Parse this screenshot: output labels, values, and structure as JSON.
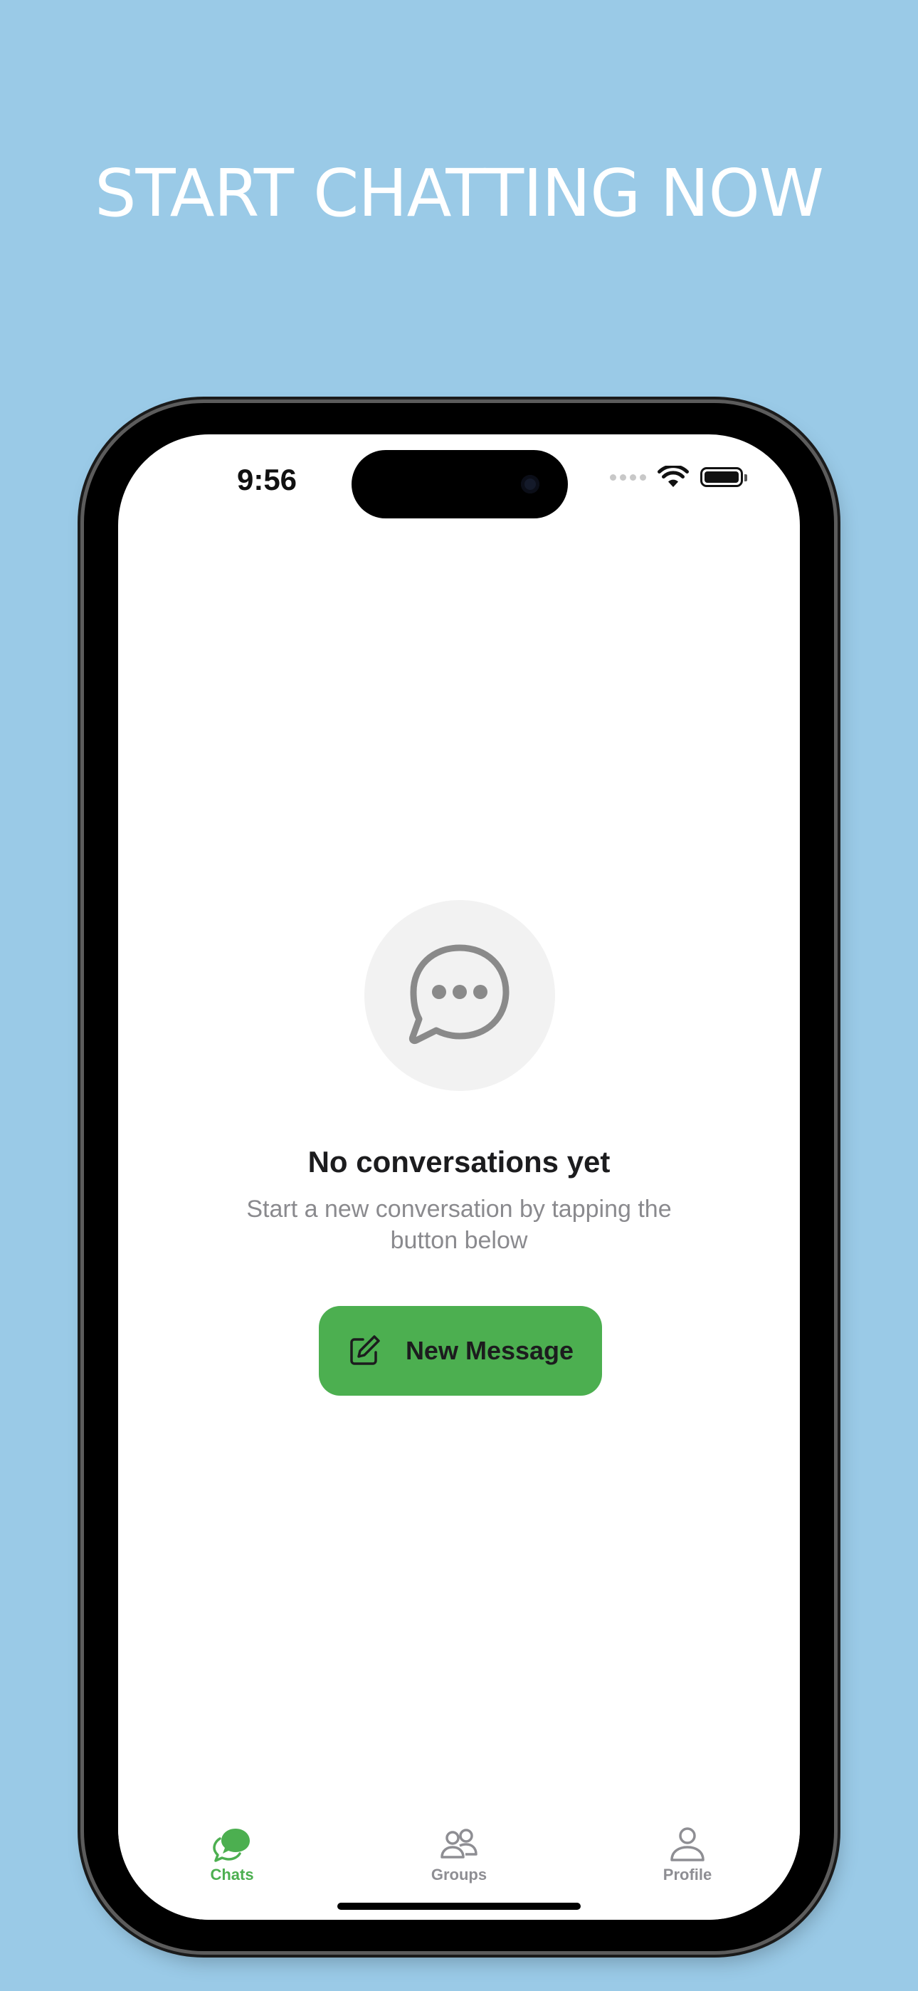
{
  "headline": "START CHATTING NOW",
  "status_bar": {
    "time": "9:56"
  },
  "empty_state": {
    "icon": "chat-bubble-ellipsis-icon",
    "title": "No conversations yet",
    "subtitle": "Start a new conversation by tapping the button below"
  },
  "new_message_button": {
    "icon": "compose-icon",
    "label": "New Message"
  },
  "tab_bar": {
    "items": [
      {
        "label": "Chats",
        "icon": "chat-bubbles-icon",
        "active": true
      },
      {
        "label": "Groups",
        "icon": "people-icon",
        "active": false
      },
      {
        "label": "Profile",
        "icon": "person-icon",
        "active": false
      }
    ]
  },
  "colors": {
    "background": "#9ACAE7",
    "accent": "#4CAF50",
    "inactive": "#8E8E93"
  }
}
